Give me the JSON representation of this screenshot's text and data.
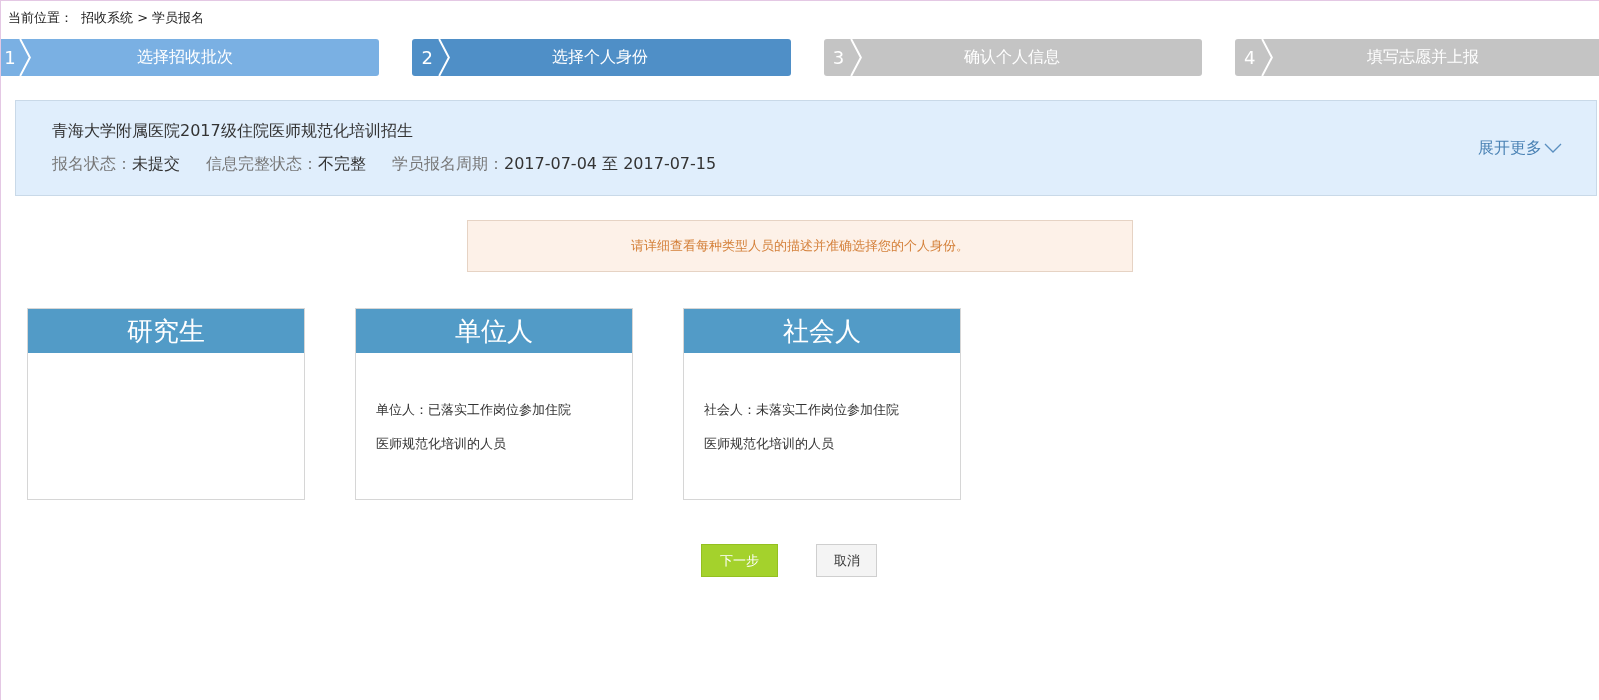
{
  "breadcrumb": {
    "label": "当前位置：",
    "path": "招收系统 > 学员报名"
  },
  "steps": [
    {
      "number": "1",
      "label": "选择招收批次",
      "kind": "done"
    },
    {
      "number": "2",
      "label": "选择个人身份",
      "kind": "current"
    },
    {
      "number": "3",
      "label": "确认个人信息",
      "kind": "todo"
    },
    {
      "number": "4",
      "label": "填写志愿并上报",
      "kind": "todo"
    }
  ],
  "info_panel": {
    "title": "青海大学附属医院2017级住院医师规范化培训招生",
    "fields": [
      {
        "label": "报名状态：",
        "value": "未提交"
      },
      {
        "label": "信息完整状态：",
        "value": "不完整"
      },
      {
        "label": "学员报名周期：",
        "value": "2017-07-04 至 2017-07-15"
      }
    ],
    "expand_link": "展开更多"
  },
  "notice": "请详细查看每种类型人员的描述并准确选择您的个人身份。",
  "identity_cards": [
    {
      "title": "研究生"
    },
    {
      "title": "单位人",
      "lines": [
        "单位人：已落实工作岗位参加住院",
        "医师规范化培训的人员"
      ]
    },
    {
      "title": "社会人",
      "lines": [
        "社会人：未落实工作岗位参加住院",
        "医师规范化培训的人员"
      ]
    }
  ],
  "buttons": [
    {
      "label": "下一步",
      "kind": "primary"
    },
    {
      "label": "取消",
      "kind": "secondary"
    }
  ]
}
